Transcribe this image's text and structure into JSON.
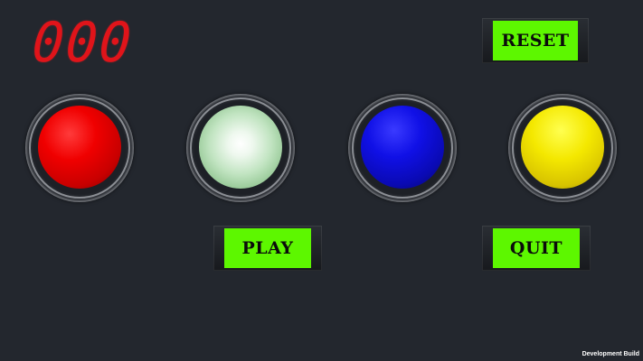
{
  "score": {
    "value": "000",
    "color": "#e0141a"
  },
  "buttons": {
    "reset": "RESET",
    "play": "PLAY",
    "quit": "QUIT",
    "color": "#5df700"
  },
  "pads": [
    {
      "color": "red"
    },
    {
      "color": "green",
      "lit": true
    },
    {
      "color": "blue"
    },
    {
      "color": "yellow"
    }
  ],
  "footer": {
    "build_label": "Development Build"
  }
}
